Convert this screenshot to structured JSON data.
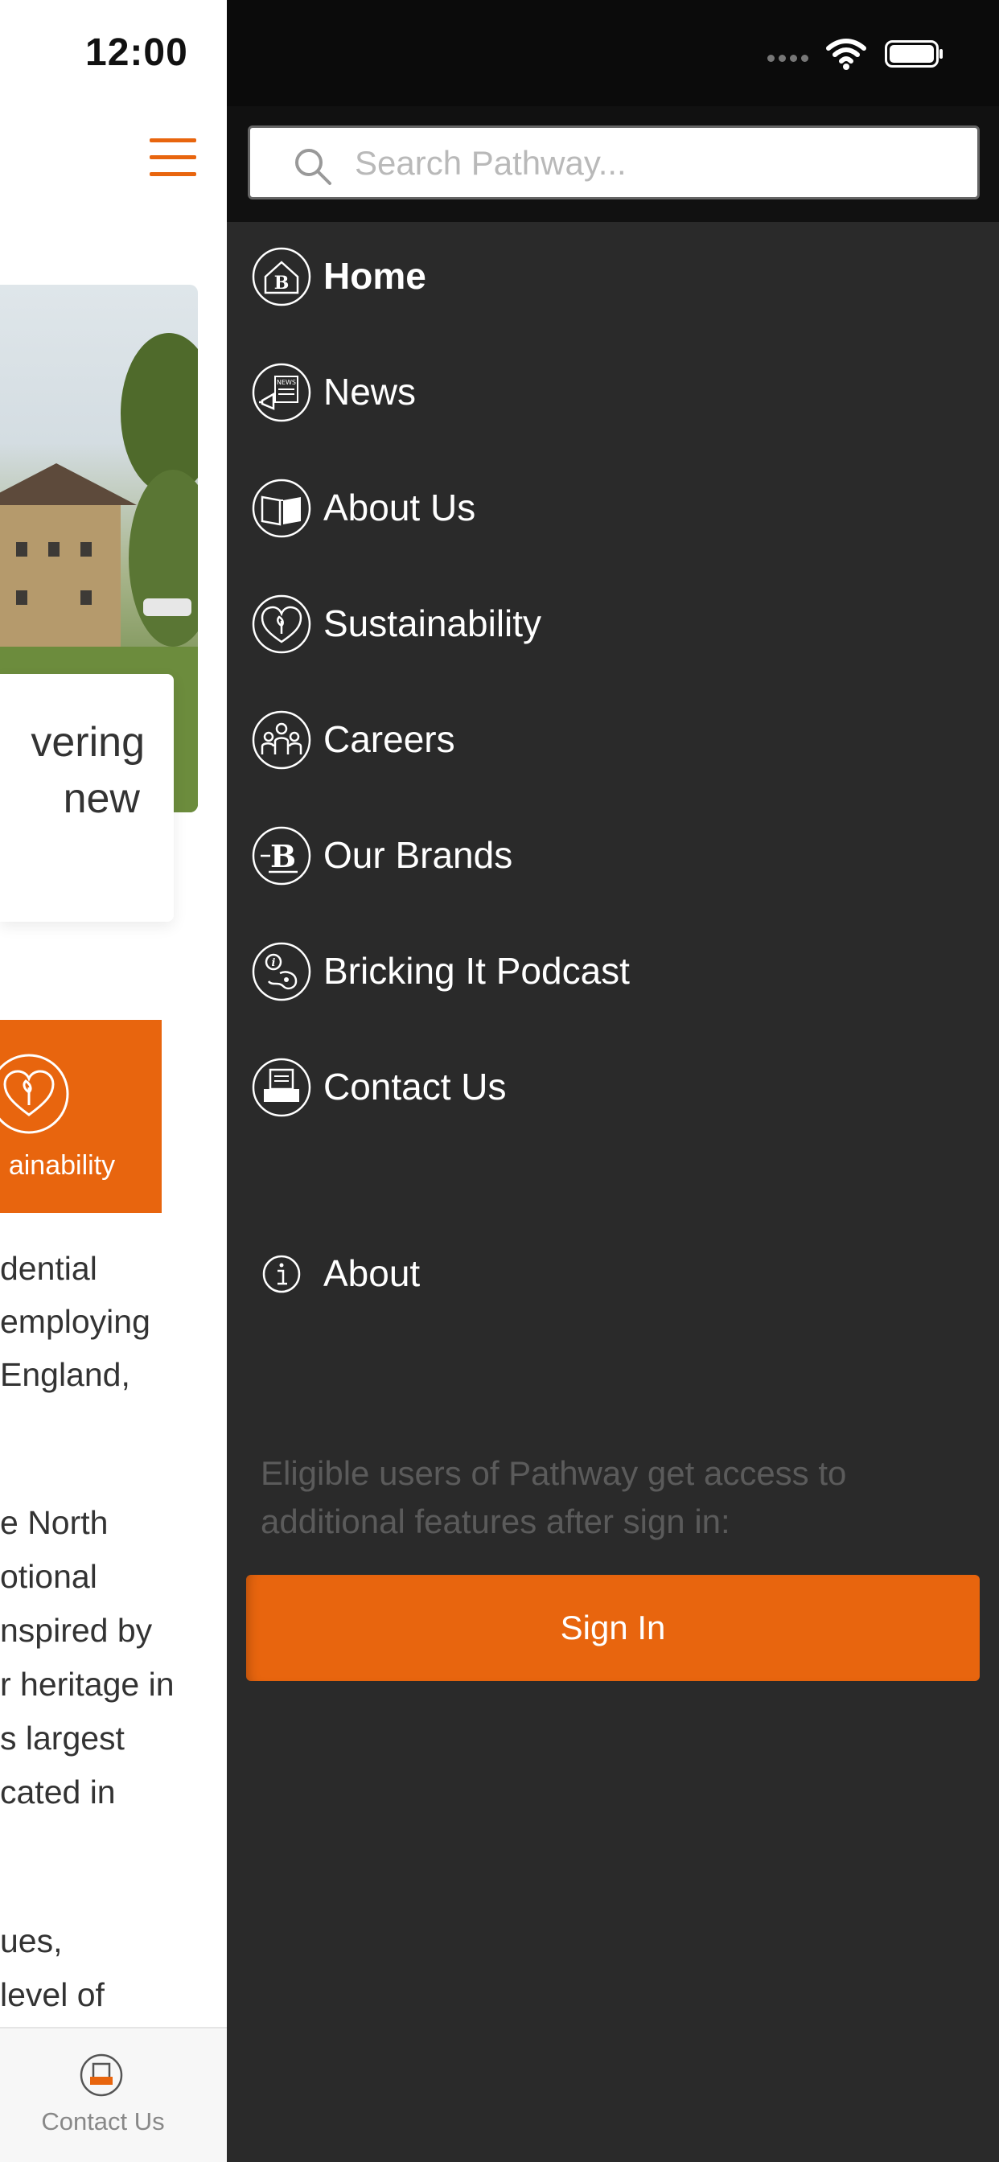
{
  "status_bar": {
    "time": "12:00"
  },
  "search": {
    "placeholder": "Search Pathway..."
  },
  "menu": {
    "items": [
      {
        "label": "Home",
        "icon": "home-brand-icon"
      },
      {
        "label": "News",
        "icon": "news-icon"
      },
      {
        "label": "About Us",
        "icon": "book-icon"
      },
      {
        "label": "Sustainability",
        "icon": "heart-leaf-icon"
      },
      {
        "label": "Careers",
        "icon": "people-icon"
      },
      {
        "label": "Our Brands",
        "icon": "brand-b-icon"
      },
      {
        "label": "Bricking It Podcast",
        "icon": "podcast-icon"
      },
      {
        "label": "Contact Us",
        "icon": "contact-icon"
      }
    ],
    "about_label": "About"
  },
  "signin": {
    "info": "Eligible users of Pathway get access to additional features after sign in:",
    "button_label": "Sign In"
  },
  "background_page": {
    "card_title_line1": "vering",
    "card_title_line2": "new",
    "tile_label": "ainability",
    "paragraph1": [
      "dential",
      " employing",
      "England,"
    ],
    "paragraph2": [
      "e North",
      "otional",
      "nspired by",
      "r heritage in",
      "s largest",
      "cated in"
    ],
    "paragraph3": [
      "ues,",
      "level of"
    ],
    "tab_contact_label": "Contact Us"
  },
  "colors": {
    "accent": "#e8650e",
    "drawer_bg": "#2a2a2a",
    "status_bg": "#0b0b0b"
  }
}
